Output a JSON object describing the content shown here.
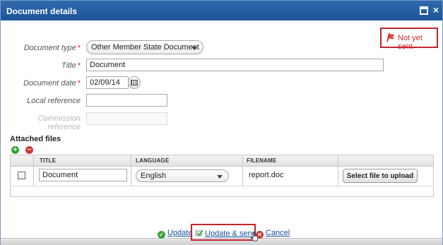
{
  "dialog": {
    "title": "Document details"
  },
  "status": {
    "text": "Not yet sent",
    "color": "#d2262d"
  },
  "form": {
    "document_type": {
      "label": "Document type",
      "required": "*",
      "value": "Other Member State Document"
    },
    "title": {
      "label": "Title",
      "required": "*",
      "value": "Document"
    },
    "document_date": {
      "label": "Document date",
      "required": "*",
      "value": "02/09/14"
    },
    "local_reference": {
      "label": "Local reference",
      "value": ""
    },
    "commission_reference": {
      "label": "Commission reference",
      "value": ""
    }
  },
  "attached_files": {
    "heading": "Attached files",
    "columns": [
      "TITLE",
      "LANGUAGE",
      "FILENAME"
    ],
    "rows": [
      {
        "title": "Document",
        "language": "English",
        "filename": "report.doc",
        "upload_label": "Select file to upload"
      }
    ]
  },
  "actions": {
    "update": "Update",
    "update_send": "Update & send",
    "cancel": "Cancel"
  }
}
